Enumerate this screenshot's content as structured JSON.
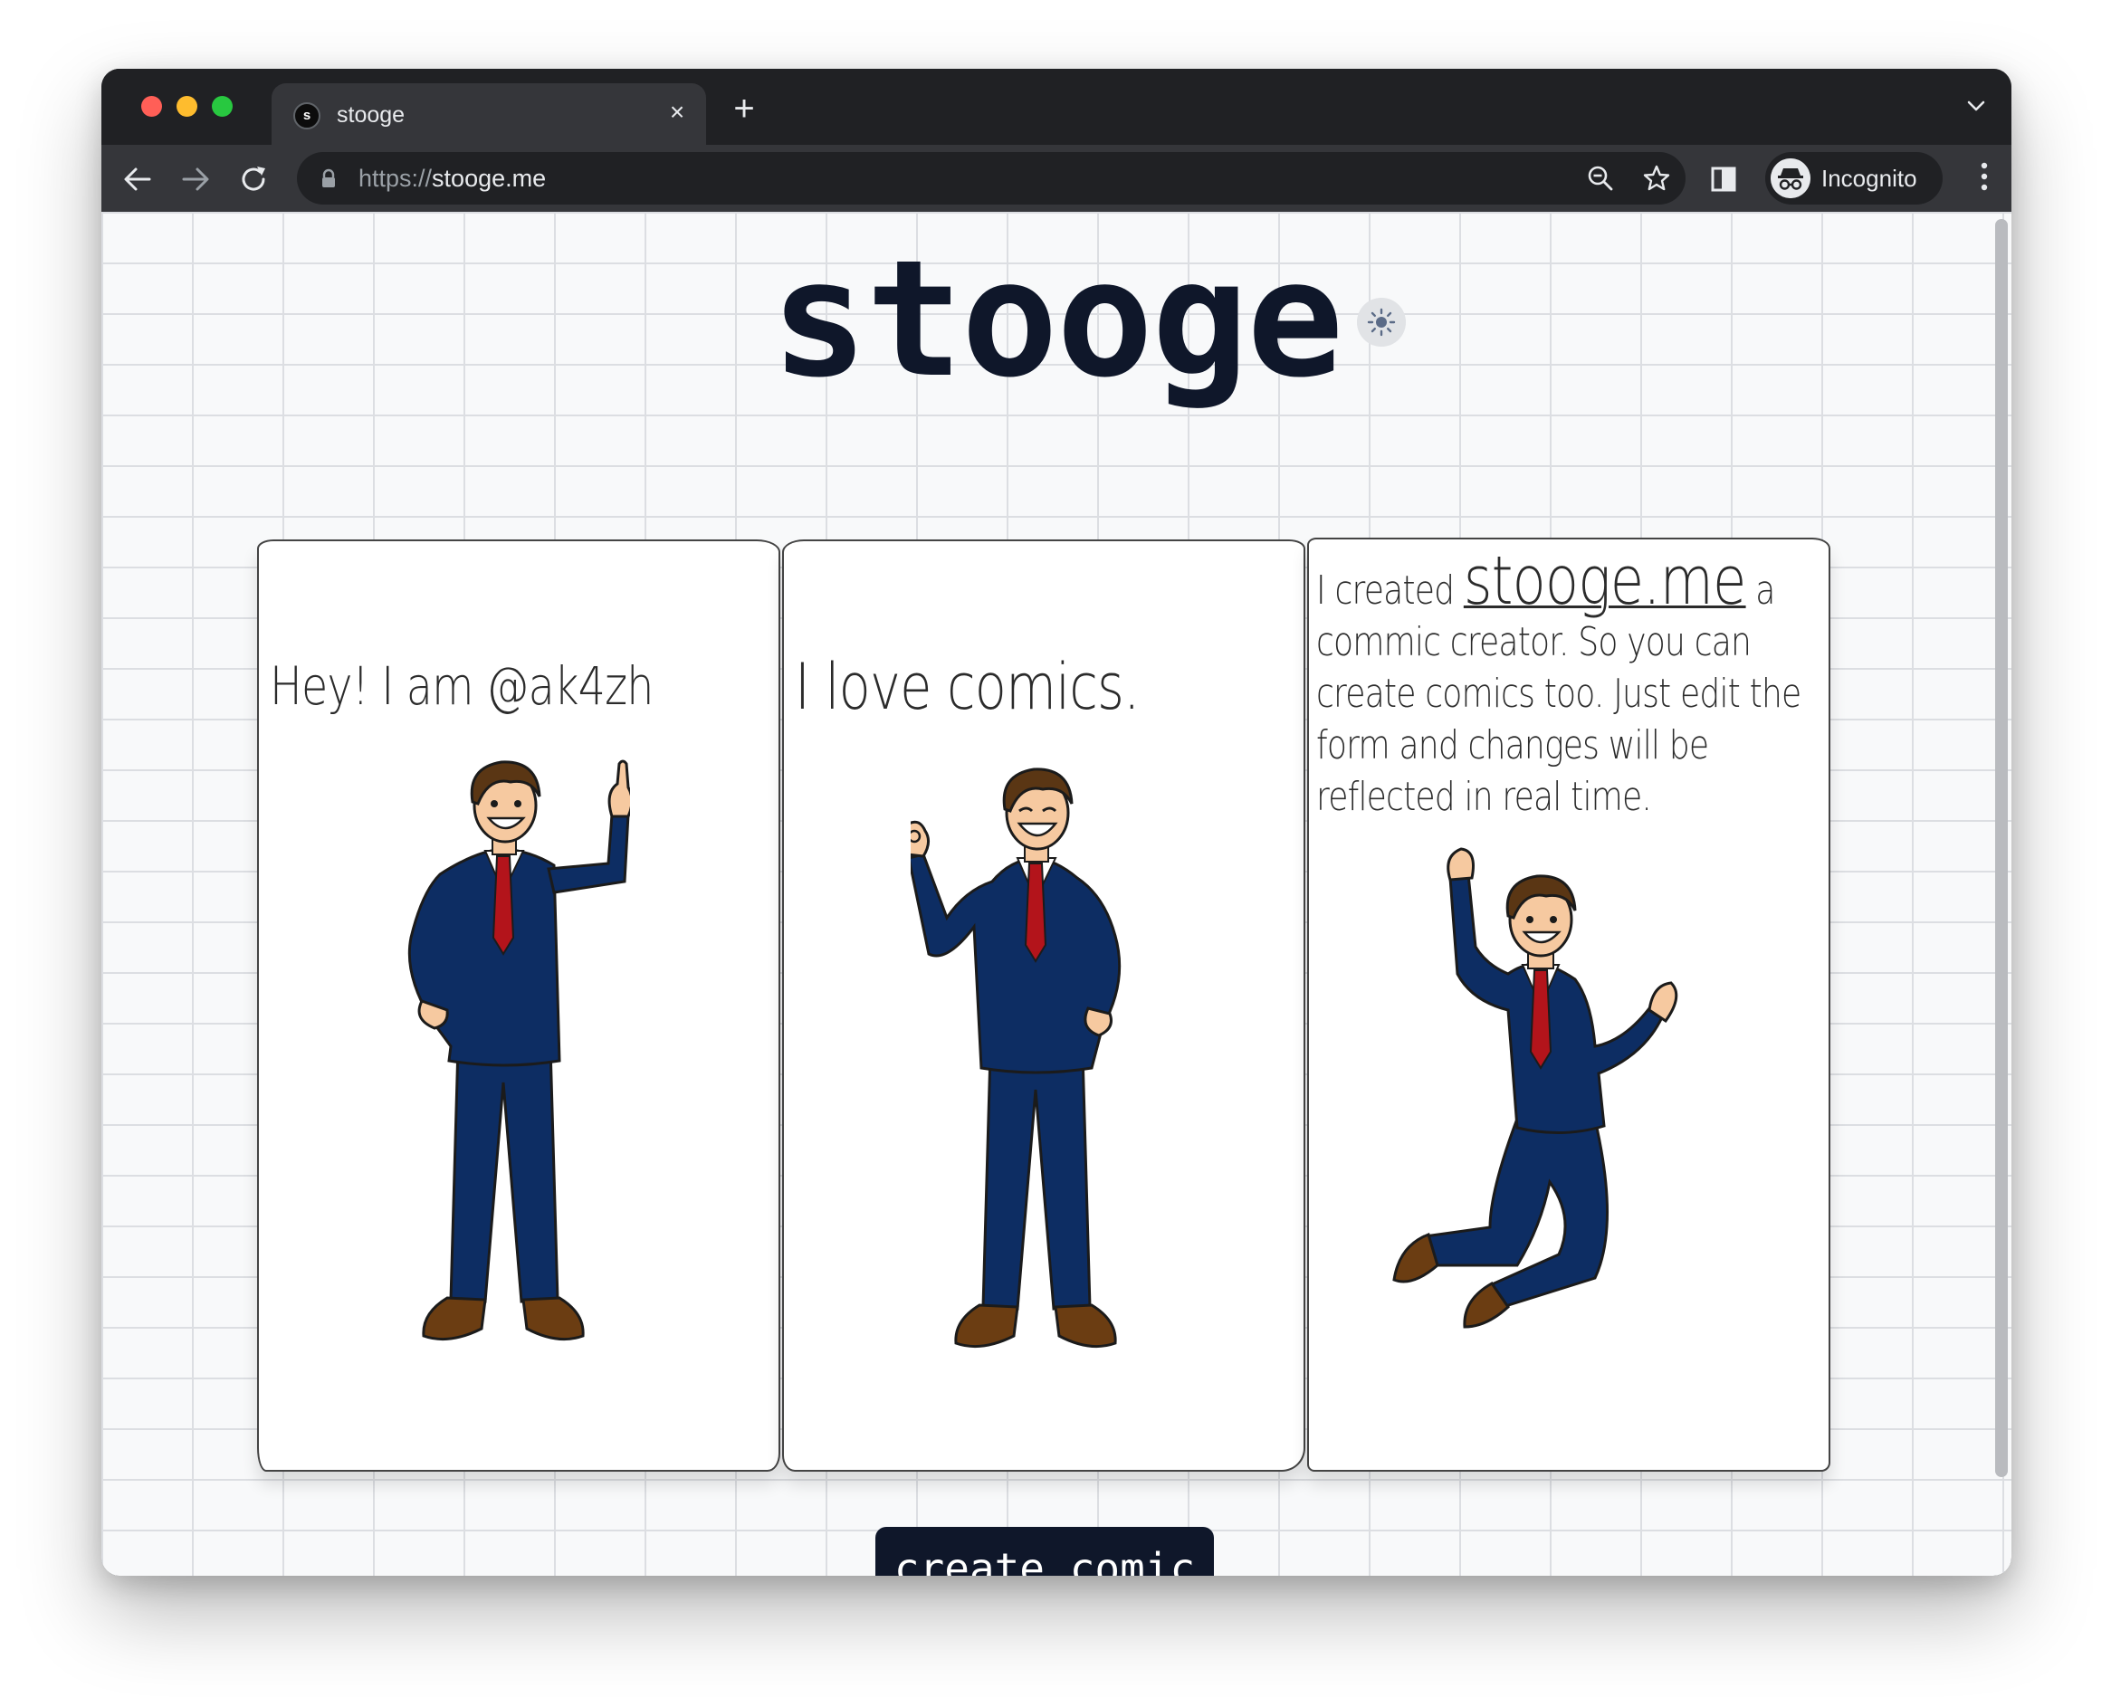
{
  "browser": {
    "tab": {
      "favicon_letter": "s",
      "title": "stooge",
      "close": "×"
    },
    "new_tab": "+",
    "url_scheme": "https://",
    "url_host": "stooge.me",
    "profile_label": "Incognito"
  },
  "page": {
    "title": "stooge",
    "panels": [
      {
        "text": "Hey! I am @ak4zh",
        "pose": "pointing-up"
      },
      {
        "text": "I love comics.",
        "pose": "ok-sign"
      },
      {
        "text_before": "I created ",
        "link": "stooge.me",
        "text_after": " a commic creator. So you can create comics too. Just edit the form and changes will be reflected in real time.",
        "pose": "jumping"
      }
    ],
    "cta_label": "create comic"
  },
  "colors": {
    "accent": "#0f172a",
    "suit": "#0d2d63",
    "tie": "#b3141b"
  }
}
